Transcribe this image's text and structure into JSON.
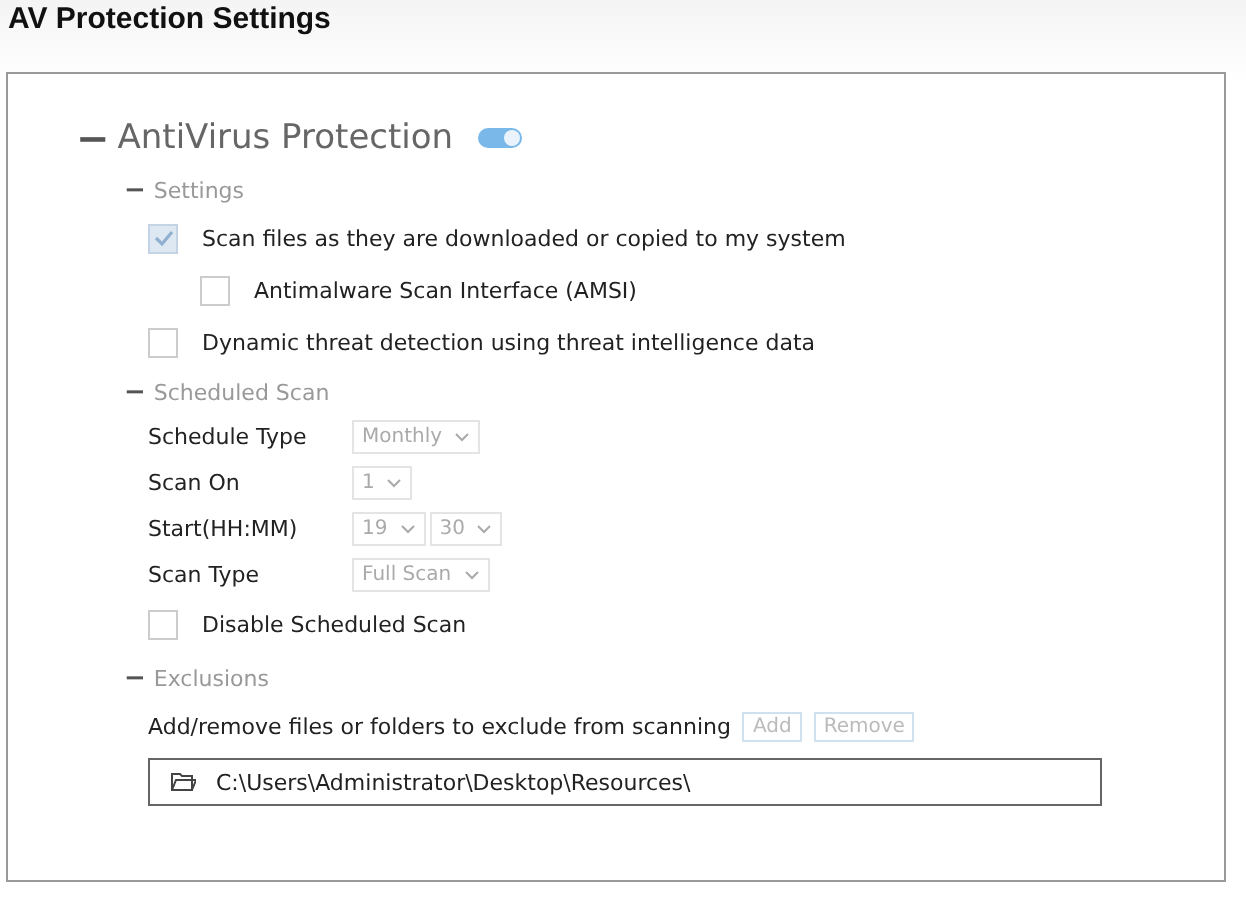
{
  "title": "AV Protection Settings",
  "section": {
    "toggle": "−",
    "label": "AntiVirus Protection",
    "on": true
  },
  "settings": {
    "toggle": "−",
    "label": "Settings",
    "options": [
      {
        "label": "Scan files as they are downloaded or copied to my system",
        "checked": true,
        "disabled": true,
        "indent": false
      },
      {
        "label": "Antimalware Scan Interface (AMSI)",
        "checked": false,
        "disabled": false,
        "indent": true
      },
      {
        "label": "Dynamic threat detection using threat intelligence data",
        "checked": false,
        "disabled": false,
        "indent": false
      }
    ]
  },
  "scheduled": {
    "toggle": "−",
    "label": "Scheduled Scan",
    "fields": [
      {
        "label": "Schedule Type",
        "selects": [
          {
            "value": "Monthly"
          }
        ]
      },
      {
        "label": "Scan On",
        "selects": [
          {
            "value": "1"
          }
        ]
      },
      {
        "label": "Start(HH:MM)",
        "selects": [
          {
            "value": "19"
          },
          {
            "value": "30"
          }
        ]
      },
      {
        "label": "Scan Type",
        "selects": [
          {
            "value": "Full Scan"
          }
        ]
      }
    ],
    "disable": {
      "label": "Disable Scheduled Scan",
      "checked": false
    }
  },
  "exclusions": {
    "toggle": "−",
    "label": "Exclusions",
    "hint": "Add/remove files or folders to exclude from scanning",
    "buttons": [
      {
        "label": "Add",
        "disabled": true
      },
      {
        "label": "Remove",
        "disabled": true
      }
    ],
    "path": "C:\\Users\\Administrator\\Desktop\\Resources\\"
  }
}
